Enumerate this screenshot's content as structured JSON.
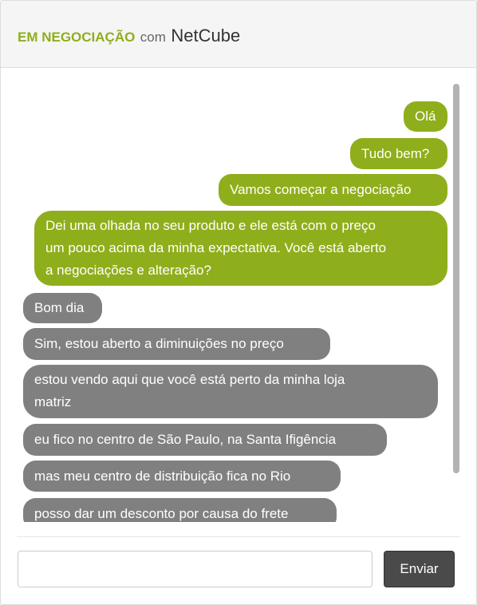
{
  "header": {
    "status": "EM NEGOCIAÇÃO",
    "with": "com",
    "partner": "NetCube"
  },
  "messages": [
    {
      "side": "sent",
      "text": "Olá"
    },
    {
      "side": "sent",
      "text": "Tudo bem?"
    },
    {
      "side": "sent",
      "text": "Vamos começar a negociação"
    },
    {
      "side": "sent",
      "lines": [
        "Dei uma olhada no seu produto e ele está com o preço",
        "um pouco acima da minha expectativa. Você está aberto",
        "a negociações e alteração?"
      ]
    },
    {
      "side": "received",
      "text": "Bom dia"
    },
    {
      "side": "received",
      "text": "Sim, estou aberto a diminuições no preço"
    },
    {
      "side": "received",
      "lines": [
        "estou vendo aqui que você está perto da minha loja",
        "matriz"
      ]
    },
    {
      "side": "received",
      "text": "eu fico no centro de São Paulo, na Santa Ifigência"
    },
    {
      "side": "received",
      "text": "mas meu centro de distribuição fica no Rio"
    },
    {
      "side": "received",
      "text": "posso dar um desconto por causa do frete"
    }
  ],
  "composer": {
    "input_value": "",
    "send_label": "Enviar"
  },
  "colors": {
    "sent_bubble": "#8fae1b",
    "received_bubble": "#808080",
    "accent": "#8fae1b"
  }
}
